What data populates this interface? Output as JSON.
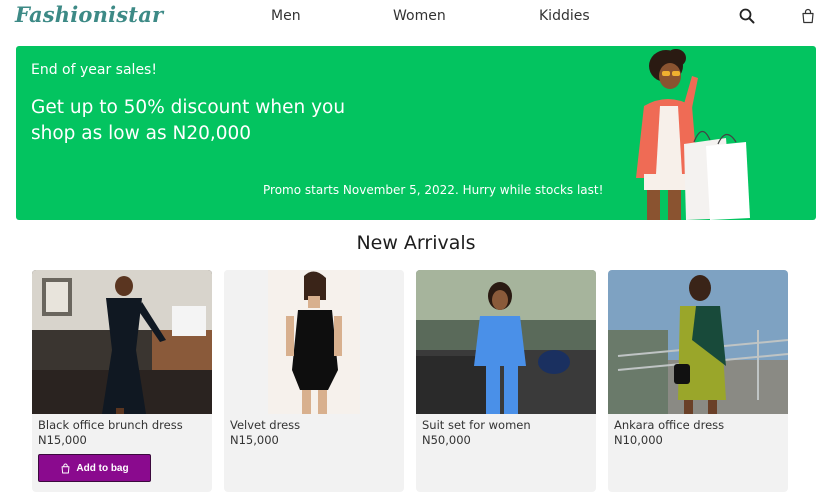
{
  "header": {
    "logo": "Fashionistar",
    "nav": [
      {
        "label": "Men"
      },
      {
        "label": "Women"
      },
      {
        "label": "Kiddies"
      }
    ]
  },
  "banner": {
    "eyebrow": "End of year sales!",
    "headline": "Get up to 50% discount when you shop as low as N20,000",
    "promo": "Promo starts November 5, 2022. Hurry while stocks last!"
  },
  "section": {
    "title": "New Arrivals"
  },
  "products": [
    {
      "name": "Black office brunch dress",
      "price": "N15,000"
    },
    {
      "name": "Velvet dress",
      "price": "N15,000"
    },
    {
      "name": "Suit set for women",
      "price": "N50,000"
    },
    {
      "name": "Ankara office dress",
      "price": "N10,000"
    }
  ],
  "add_to_bag_label": "Add to bag",
  "colors": {
    "brand": "#3d8a86",
    "banner": "#03c460",
    "button": "#8a0a8e",
    "card": "#f2f2f2"
  },
  "icons": {
    "search": "search-icon",
    "bag": "shopping-bag-icon"
  }
}
